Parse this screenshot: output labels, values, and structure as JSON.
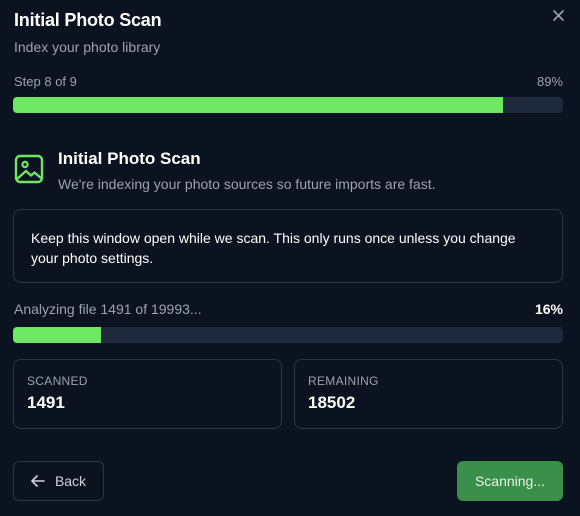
{
  "header": {
    "title": "Initial Photo Scan",
    "subtitle": "Index your photo library",
    "close_icon": "close-icon"
  },
  "steps": {
    "label": "Step 8 of 9",
    "percent_label": "89%",
    "progress_fraction": 0.89
  },
  "section": {
    "icon": "image-icon",
    "title": "Initial Photo Scan",
    "description": "We're indexing your photo sources so future imports are fast."
  },
  "info": {
    "message": "Keep this window open while we scan. This only runs once unless you change your photo settings."
  },
  "scan": {
    "status": "Analyzing file 1491 of 19993...",
    "percent_label": "16%",
    "progress_fraction": 0.16
  },
  "stats": {
    "scanned_label": "SCANNED",
    "scanned_value": "1491",
    "remaining_label": "REMAINING",
    "remaining_value": "18502"
  },
  "footer": {
    "back_label": "Back",
    "back_icon": "arrow-left-icon",
    "action_label": "Scanning..."
  },
  "colors": {
    "background": "#0b1220",
    "accent": "#6ee764",
    "track": "#1e293b",
    "border": "#2b3546",
    "action_button": "#3a8f4a"
  }
}
